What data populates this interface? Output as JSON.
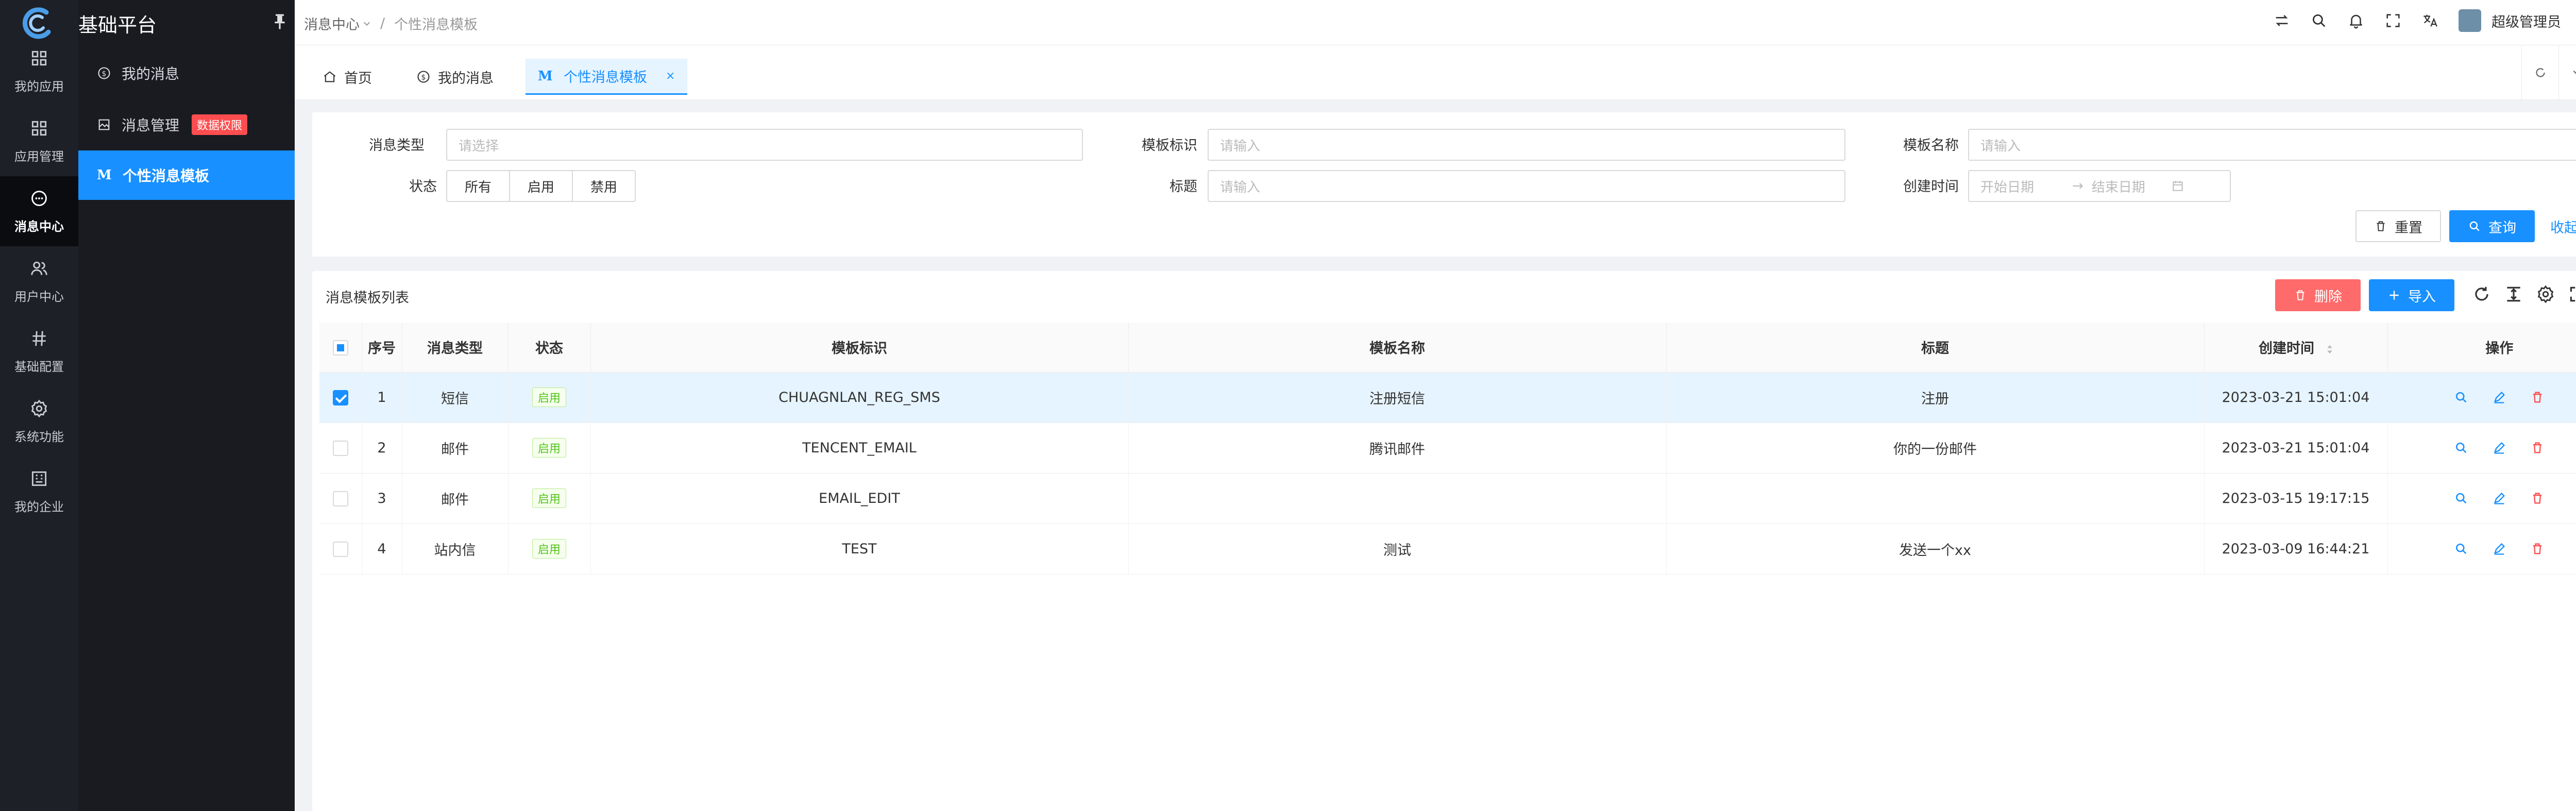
{
  "app": {
    "title": "基础平台"
  },
  "rail": [
    {
      "label": "我的应用",
      "icon": "grid-icon",
      "active": false
    },
    {
      "label": "应用管理",
      "icon": "apps-icon",
      "active": false
    },
    {
      "label": "消息中心",
      "icon": "message-icon",
      "active": true
    },
    {
      "label": "用户中心",
      "icon": "users-icon",
      "active": false
    },
    {
      "label": "基础配置",
      "icon": "hash-icon",
      "active": false
    },
    {
      "label": "系统功能",
      "icon": "gear-icon",
      "active": false
    },
    {
      "label": "我的企业",
      "icon": "building-icon",
      "active": false
    }
  ],
  "submenu": {
    "items": [
      {
        "label": "我的消息",
        "icon": "dollar-circle-icon"
      },
      {
        "label": "消息管理",
        "icon": "image-icon",
        "badge": "数据权限"
      },
      {
        "label": "个性消息模板",
        "icon": "m-icon",
        "icon_text": "M"
      }
    ]
  },
  "header": {
    "breadcrumb": [
      "消息中心",
      "个性消息模板"
    ],
    "breadcrumb_sep": "/",
    "user": "超级管理员"
  },
  "tabs": [
    {
      "label": "首页",
      "icon": "home-icon"
    },
    {
      "label": "我的消息",
      "icon": "dollar-circle-icon"
    },
    {
      "label": "个性消息模板",
      "icon": "m-icon",
      "icon_text": "M",
      "active": true,
      "close": "×"
    }
  ],
  "search": {
    "type_label": "消息类型",
    "type_placeholder": "请选择",
    "key_label": "模板标识",
    "key_placeholder": "请输入",
    "name_label": "模板名称",
    "name_placeholder": "请输入",
    "status_label": "状态",
    "status_options": [
      "所有",
      "启用",
      "禁用"
    ],
    "title_label": "标题",
    "title_placeholder": "请输入",
    "time_label": "创建时间",
    "start_placeholder": "开始日期",
    "end_placeholder": "结束日期",
    "range_sep": "→",
    "reset": "重置",
    "query": "查询",
    "collapse": "收起"
  },
  "table": {
    "title": "消息模板列表",
    "delete": "删除",
    "import": "导入",
    "columns": [
      "序号",
      "消息类型",
      "状态",
      "模板标识",
      "模板名称",
      "标题",
      "创建时间",
      "操作"
    ],
    "rows": [
      {
        "no": "1",
        "type": "短信",
        "status": "启用",
        "key": "CHUAGNLAN_REG_SMS",
        "name": "注册短信",
        "title": "注册",
        "time": "2023-03-21 15:01:04",
        "checked": true
      },
      {
        "no": "2",
        "type": "邮件",
        "status": "启用",
        "key": "TENCENT_EMAIL",
        "name": "腾讯邮件",
        "title": "你的一份邮件",
        "time": "2023-03-21 15:01:04",
        "checked": false
      },
      {
        "no": "3",
        "type": "邮件",
        "status": "启用",
        "key": "EMAIL_EDIT",
        "name": "",
        "title": "",
        "time": "2023-03-15 19:17:15",
        "checked": false
      },
      {
        "no": "4",
        "type": "站内信",
        "status": "启用",
        "key": "TEST",
        "name": "测试",
        "title": "发送一个xx",
        "time": "2023-03-09 16:44:21",
        "checked": false
      }
    ]
  },
  "colors": {
    "primary": "#1890ff",
    "danger": "#ff6b6b",
    "sidebar": "#1d2027",
    "success": "#52c41a"
  }
}
